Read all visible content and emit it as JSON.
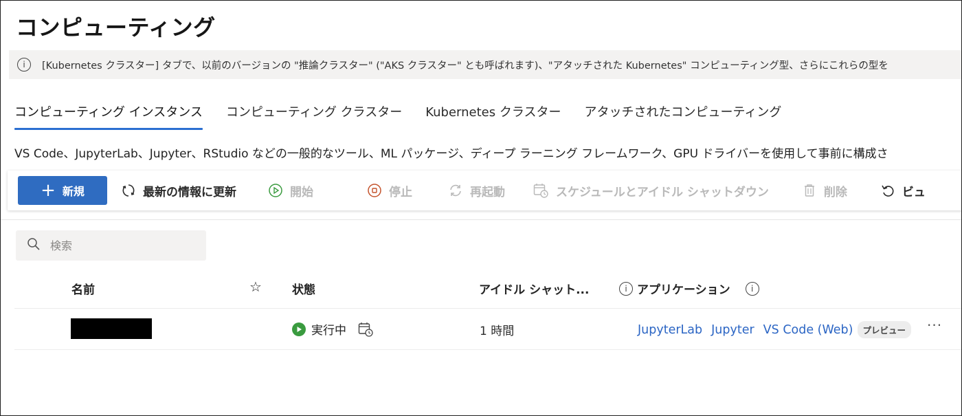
{
  "page": {
    "title": "コンピューティング",
    "info_text": "[Kubernetes クラスター] タブで、以前のバージョンの \"推論クラスター\" (\"AKS クラスター\" とも呼ばれます)、\"アタッチされた Kubernetes\" コンピューティング型、さらにこれらの型を"
  },
  "tabs": [
    {
      "label": "コンピューティング インスタンス",
      "active": true
    },
    {
      "label": "コンピューティング クラスター",
      "active": false
    },
    {
      "label": "Kubernetes クラスター",
      "active": false
    },
    {
      "label": "アタッチされたコンピューティング",
      "active": false
    }
  ],
  "description": "VS Code、JupyterLab、Jupyter、RStudio などの一般的なツール、ML パッケージ、ディープ ラーニング フレームワーク、GPU ドライバーを使用して事前に構成さ",
  "toolbar": {
    "new_label": "新規",
    "refresh_label": "最新の情報に更新",
    "start_label": "開始",
    "stop_label": "停止",
    "restart_label": "再起動",
    "schedule_label": "スケジュールとアイドル シャットダウン",
    "delete_label": "削除",
    "view_label": "ビュ"
  },
  "search": {
    "placeholder": "検索"
  },
  "table": {
    "columns": {
      "name": "名前",
      "state": "状態",
      "idle": "アイドル シャット...",
      "apps": "アプリケーション"
    },
    "rows": [
      {
        "state": "実行中",
        "idle": "1 時間",
        "apps": [
          "JupyterLab",
          "Jupyter",
          "VS Code (Web)"
        ],
        "preview_badge": "プレビュー"
      }
    ]
  },
  "colors": {
    "primary": "#2f6cc1",
    "tab_underline": "#2b6fd1",
    "running": "#3a9b3f",
    "link": "#2b65c4",
    "stop_icon": "#c4532c",
    "start_icon": "#3a9b3f"
  }
}
